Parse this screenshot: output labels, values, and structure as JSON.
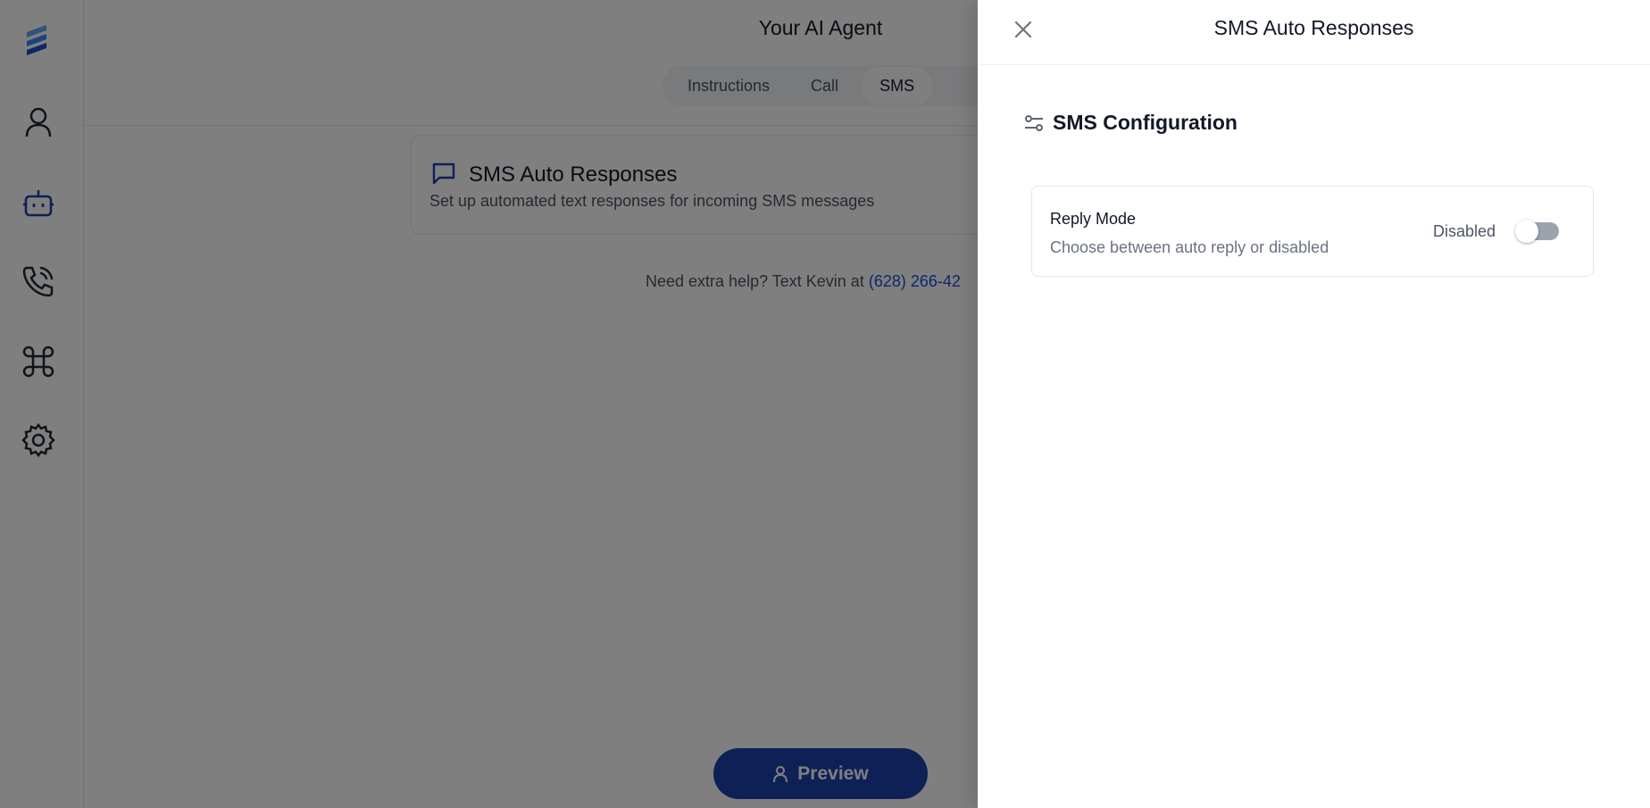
{
  "main": {
    "title": "Your AI Agent",
    "tabs": [
      {
        "label": "Instructions"
      },
      {
        "label": "Call"
      },
      {
        "label": "SMS"
      }
    ],
    "card": {
      "title": "SMS Auto Responses",
      "description": "Set up automated text responses for incoming SMS messages"
    },
    "help": {
      "text": "Need extra help? Text Kevin at ",
      "phone": "(628) 266-42"
    },
    "preview_label": "Preview"
  },
  "drawer": {
    "title": "SMS Auto Responses",
    "section_title": "SMS Configuration",
    "setting": {
      "label": "Reply Mode",
      "description": "Choose between auto reply or disabled",
      "status": "Disabled",
      "enabled": false
    }
  },
  "colors": {
    "accent": "#1e40af",
    "logo": "#2563eb",
    "overlay": "rgba(0,0,0,0.5)"
  }
}
